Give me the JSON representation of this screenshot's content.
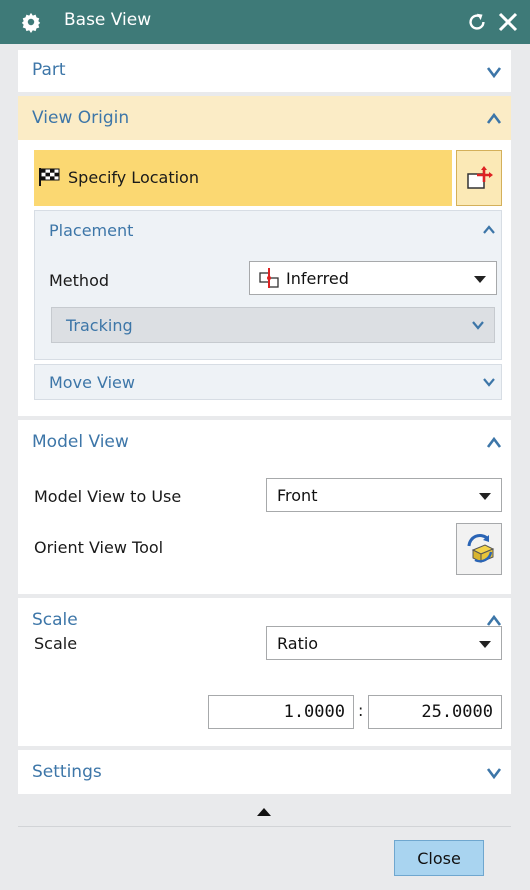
{
  "window": {
    "title": "Base View",
    "icon": "gear-icon",
    "reset_icon": "reset-icon",
    "close_icon": "close-icon"
  },
  "colors": {
    "titlebar": "#3e7a78",
    "accent_text": "#3d76a8",
    "highlight_row": "#fbd872",
    "highlight_header": "#fbecc6",
    "button": "#a9d4f0"
  },
  "part": {
    "title": "Part"
  },
  "view_origin": {
    "title": "View Origin",
    "specify_location": "Specify Location",
    "specify_icon": "checkered-flag-icon",
    "point_dialog_icon": "point-dialog-icon",
    "placement": {
      "title": "Placement",
      "method_label": "Method",
      "method_value": "Inferred",
      "method_icon": "inferred-icon",
      "tracking_title": "Tracking"
    },
    "move_view": "Move View"
  },
  "model_view": {
    "title": "Model View",
    "use_label": "Model View to Use",
    "use_value": "Front",
    "orient_label": "Orient View Tool",
    "orient_icon": "orient-view-icon"
  },
  "scale": {
    "title": "Scale",
    "label": "Scale",
    "type_value": "Ratio",
    "numerator": "1.0000",
    "separator": ":",
    "denominator": "25.0000"
  },
  "settings": {
    "title": "Settings"
  },
  "footer": {
    "close_label": "Close",
    "collapse_icon": "collapse-up-icon"
  }
}
